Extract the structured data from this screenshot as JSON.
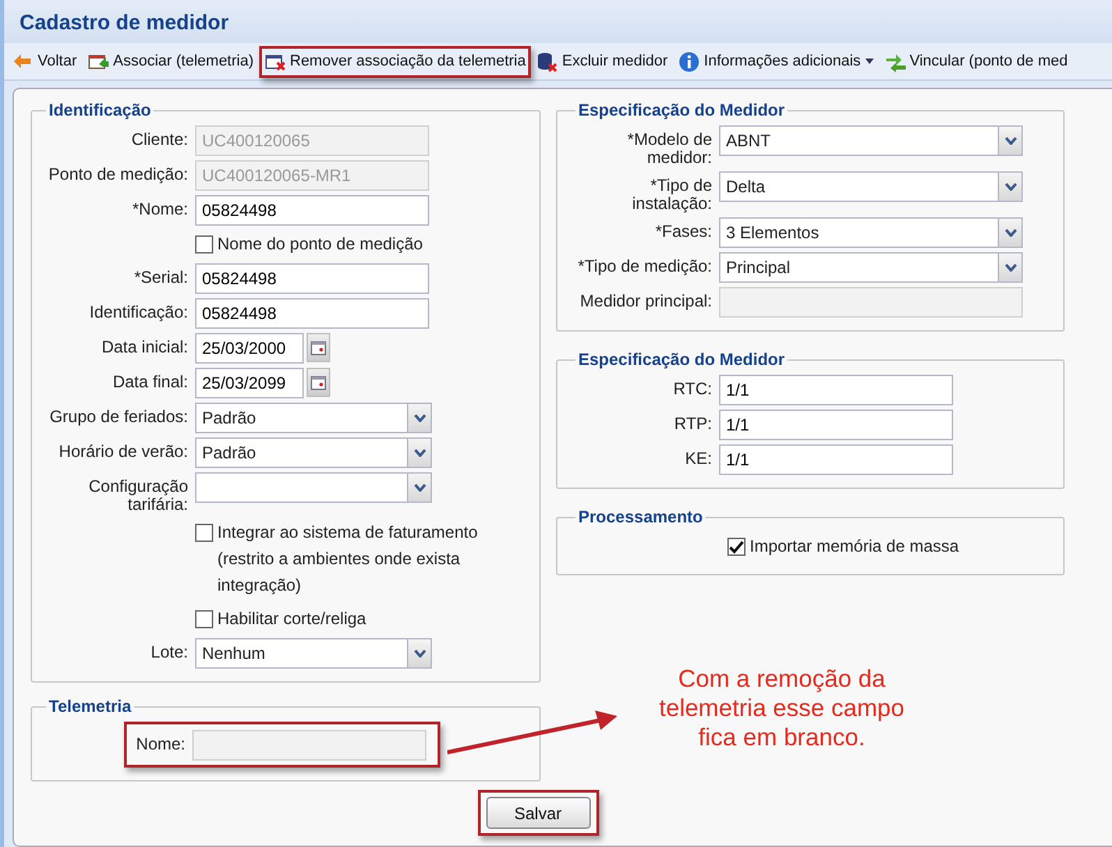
{
  "window": {
    "title": "Cadastro de medidor"
  },
  "toolbar": [
    {
      "kind": "back",
      "label": "Voltar",
      "highlighted": false,
      "has_menu": false
    },
    {
      "kind": "associate",
      "label": "Associar (telemetria)",
      "highlighted": false,
      "has_menu": false
    },
    {
      "kind": "remove",
      "label": "Remover associação da telemetria",
      "highlighted": true,
      "has_menu": false
    },
    {
      "kind": "delete",
      "label": "Excluir medidor",
      "highlighted": false,
      "has_menu": false
    },
    {
      "kind": "info",
      "label": "Informações adicionais",
      "highlighted": false,
      "has_menu": true
    },
    {
      "kind": "link",
      "label": "Vincular (ponto de med",
      "highlighted": false,
      "has_menu": false
    }
  ],
  "left_sections": [
    {
      "title": "Identificação",
      "rows": [
        {
          "kind": "text",
          "label": "Cliente:",
          "value": "UC400120065",
          "disabled": true
        },
        {
          "kind": "text",
          "label": "Ponto de medição:",
          "value": "UC400120065-MR1",
          "disabled": true
        },
        {
          "kind": "text",
          "label": "*Nome:",
          "value": "05824498",
          "disabled": false
        },
        {
          "kind": "checkbox",
          "text": "Nome do ponto de medição",
          "checked": false
        },
        {
          "kind": "text",
          "label": "*Serial:",
          "value": "05824498",
          "disabled": false
        },
        {
          "kind": "text",
          "label": "Identificação:",
          "value": "05824498",
          "disabled": false
        },
        {
          "kind": "date",
          "label": "Data inicial:",
          "value": "25/03/2000"
        },
        {
          "kind": "date",
          "label": "Data final:",
          "value": "25/03/2099"
        },
        {
          "kind": "select",
          "label": "Grupo de feriados:",
          "value": "Padrão"
        },
        {
          "kind": "select",
          "label": "Horário de verão:",
          "value": "Padrão"
        },
        {
          "kind": "select",
          "label": "Configuração tarifária:"
        },
        {
          "kind": "checkbox",
          "text": "Integrar ao sistema de faturamento (restrito a ambientes onde exista integração)",
          "checked": false
        },
        {
          "kind": "checkbox",
          "text": "Habilitar corte/religa",
          "checked": false
        },
        {
          "kind": "select",
          "label": "Lote:",
          "value": "Nenhum"
        }
      ]
    },
    {
      "title": "Telemetria",
      "rows": [
        {
          "kind": "text",
          "label": "Nome:",
          "disabled": true,
          "highlighted": true
        }
      ]
    }
  ],
  "right_sections": [
    {
      "title": "Especificação do Medidor",
      "rows": [
        {
          "kind": "select",
          "label": "*Modelo de medidor:",
          "value": "ABNT"
        },
        {
          "kind": "select",
          "label": "*Tipo de instalação:",
          "value": "Delta"
        },
        {
          "kind": "select",
          "label": "*Fases:",
          "value": "3 Elementos"
        },
        {
          "kind": "select",
          "label": "*Tipo de medição:",
          "value": "Principal"
        },
        {
          "kind": "text",
          "label": "Medidor principal:",
          "disabled": true
        }
      ]
    },
    {
      "title": "Especificação do Medidor",
      "rows": [
        {
          "kind": "text",
          "label": "RTC:",
          "value": "1/1",
          "disabled": false
        },
        {
          "kind": "text",
          "label": "RTP:",
          "value": "1/1",
          "disabled": false
        },
        {
          "kind": "text",
          "label": "KE:",
          "value": "1/1",
          "disabled": false
        }
      ]
    },
    {
      "title": "Processamento",
      "rows": [
        {
          "kind": "checkbox",
          "text": "Importar memória de massa",
          "checked": true
        }
      ]
    }
  ],
  "save_button": {
    "label": "Salvar",
    "highlighted": true
  },
  "annotation": {
    "text": "Com a remoção da telemetria esse campo fica em branco."
  }
}
